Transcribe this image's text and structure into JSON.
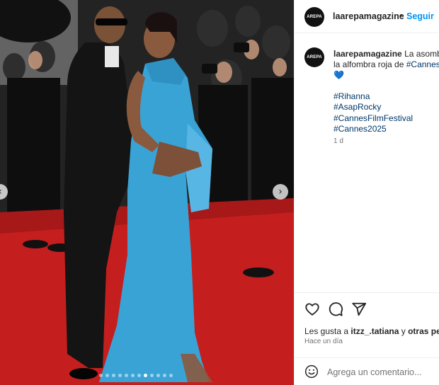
{
  "post": {
    "username": "laarepamagazine",
    "avatar_text": "AREPA",
    "separator": "•",
    "follow_label": "Seguir",
    "caption": {
      "line1_text": "La asombro",
      "line2_prefix": "la alfombra roja de ",
      "line2_link": "#Cannes",
      "line2_suffix": " c",
      "heart": "💙"
    },
    "hashtags": [
      "#Rihanna",
      "#AsapRocky",
      "#CannesFilmFestival",
      "#Cannes2025"
    ],
    "caption_age": "1 d",
    "likes": {
      "prefix": "Les gusta a ",
      "user": "itzz_.tatiana",
      "middle": " y ",
      "others": "otras perso"
    },
    "timestamp": "Hace un día",
    "comment_placeholder": "Agrega un comentario..."
  },
  "carousel": {
    "slide_count": 12,
    "active_index": 7,
    "prev_icon": "chevron-left-icon",
    "next_icon": "chevron-right-icon"
  },
  "icons": {
    "like": "heart-outline-icon",
    "comment": "comment-bubble-icon",
    "share": "paper-plane-icon",
    "emoji": "smiley-icon"
  },
  "colors": {
    "accent": "#0095f6",
    "link": "#00376b",
    "carpet": "#c8201f",
    "dress": "#3aa3d6"
  }
}
